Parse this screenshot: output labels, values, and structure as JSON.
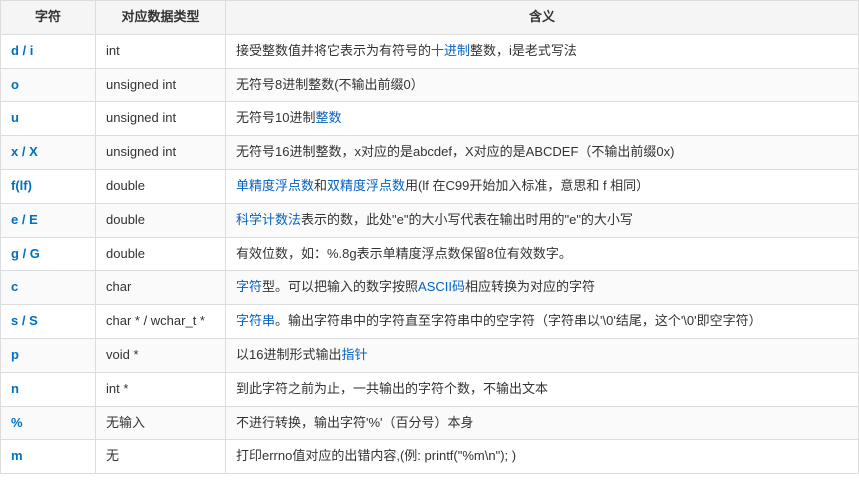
{
  "table": {
    "headers": [
      "字符",
      "对应数据类型",
      "含义"
    ],
    "rows": [
      {
        "symbol": "d / i",
        "type": "int",
        "type_has_link": false,
        "meaning_parts": [
          {
            "text": "接受整数值并将它表示为有符号的",
            "is_link": false
          },
          {
            "text": "十进制",
            "is_link": true
          },
          {
            "text": "整数，i是老式写法",
            "is_link": false
          }
        ]
      },
      {
        "symbol": "o",
        "type": "unsigned int",
        "type_has_link": false,
        "meaning_parts": [
          {
            "text": "无符号8进制整数(不输出前缀0）",
            "is_link": false
          }
        ]
      },
      {
        "symbol": "u",
        "type": "unsigned int",
        "type_has_link": false,
        "meaning_parts": [
          {
            "text": "无符号10进制",
            "is_link": false
          },
          {
            "text": "整数",
            "is_link": true
          }
        ]
      },
      {
        "symbol": "x / X",
        "type": "unsigned int",
        "type_has_link": false,
        "meaning_parts": [
          {
            "text": "无符号16进制整数，x对应的是abcdef，X对应的是ABCDEF（不输出前缀0x)",
            "is_link": false
          }
        ]
      },
      {
        "symbol": "f(lf)",
        "type": "double",
        "type_has_link": false,
        "meaning_parts": [
          {
            "text": "单精度浮点数",
            "is_link": true
          },
          {
            "text": "和",
            "is_link": false
          },
          {
            "text": "双精度浮点数",
            "is_link": true
          },
          {
            "text": "用(lf 在C99开始加入标准，意思和 f 相同）",
            "is_link": false
          }
        ]
      },
      {
        "symbol": "e / E",
        "type": "double",
        "type_has_link": false,
        "meaning_parts": [
          {
            "text": "科学计数法",
            "is_link": true
          },
          {
            "text": "表示的数，此处\"e\"的大小写代表在输出时用的\"e\"的大小写",
            "is_link": false
          }
        ]
      },
      {
        "symbol": "g / G",
        "type": "double",
        "type_has_link": false,
        "meaning_parts": [
          {
            "text": "有效位数，如：%.8g表示单精度浮点数保留8位有效数字。",
            "is_link": false
          }
        ]
      },
      {
        "symbol": "c",
        "type": "char",
        "type_has_link": false,
        "meaning_parts": [
          {
            "text": "字符",
            "is_link": true
          },
          {
            "text": "型。可以把输入的数字按照",
            "is_link": false
          },
          {
            "text": "ASCII码",
            "is_link": true
          },
          {
            "text": "相应转换为对应的字符",
            "is_link": false
          }
        ]
      },
      {
        "symbol": "s / S",
        "type": "char * / wchar_t *",
        "type_has_link": false,
        "meaning_parts": [
          {
            "text": "字符串",
            "is_link": true
          },
          {
            "text": "。输出字符串中的字符直至字符串中的空字符（字符串以'\\0'结尾，这个'\\0'即空字符）",
            "is_link": false
          }
        ]
      },
      {
        "symbol": "p",
        "type": "void *",
        "type_has_link": false,
        "meaning_parts": [
          {
            "text": "以16进制形式输出",
            "is_link": false
          },
          {
            "text": "指针",
            "is_link": true
          }
        ]
      },
      {
        "symbol": "n",
        "type": "int *",
        "type_has_link": false,
        "meaning_parts": [
          {
            "text": "到此字符之前为止，一共输出的字符个数，不输出文本",
            "is_link": false
          }
        ]
      },
      {
        "symbol": "%",
        "type": "无输入",
        "type_has_link": false,
        "meaning_parts": [
          {
            "text": "不进行转换，输出字符'%'（百分号）本身",
            "is_link": false
          }
        ]
      },
      {
        "symbol": "m",
        "type": "无",
        "type_has_link": false,
        "meaning_parts": [
          {
            "text": "打印errno值对应的出错内容,(例: printf(\"%m\\n\"); )",
            "is_link": false
          }
        ]
      }
    ]
  }
}
